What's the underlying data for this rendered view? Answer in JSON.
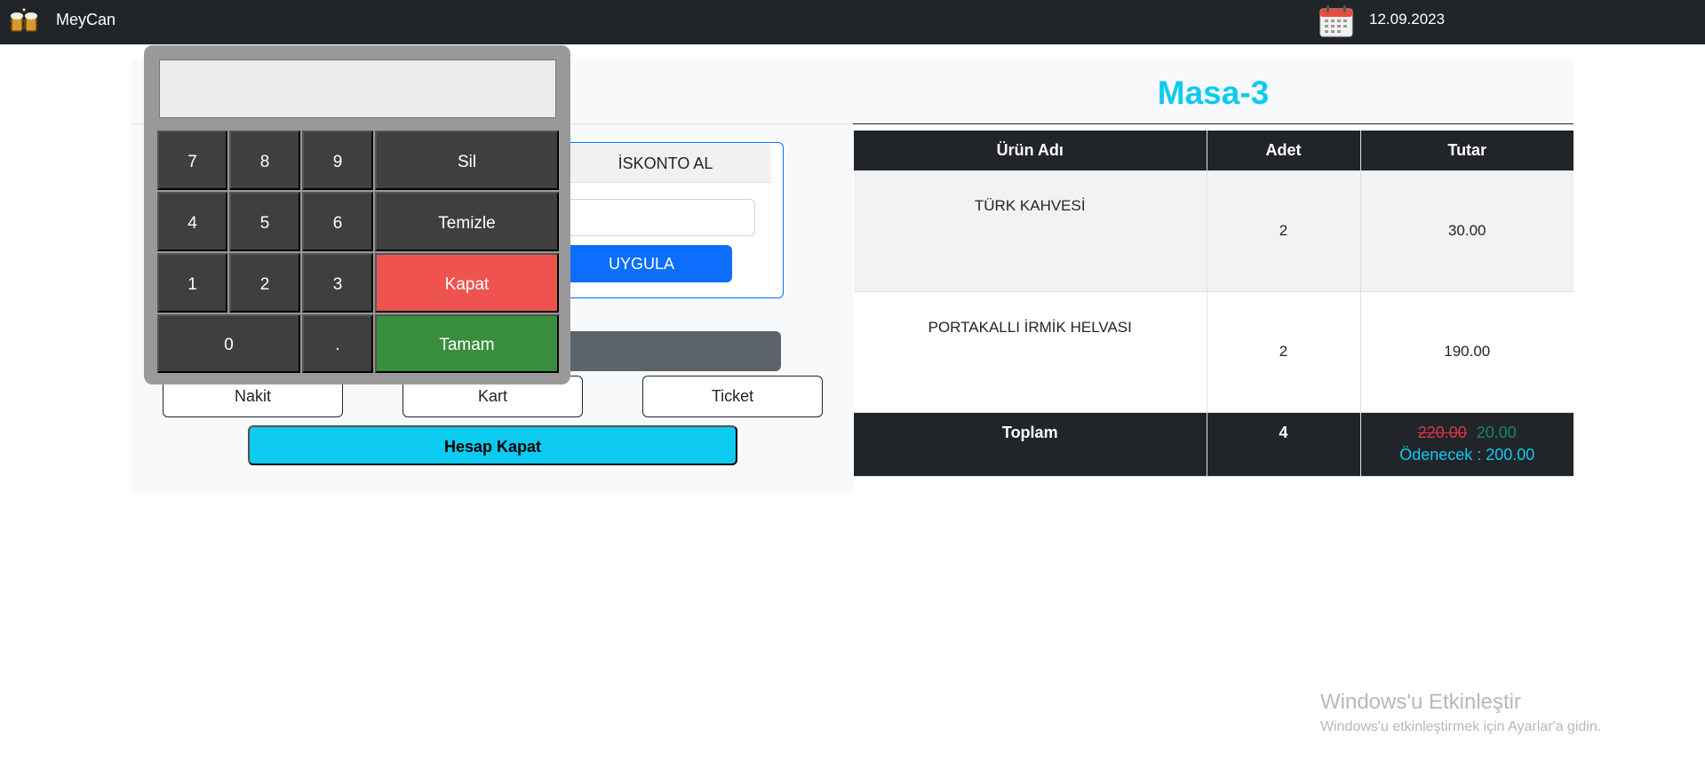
{
  "navbar": {
    "brand": "MeyCan",
    "logo_icon": "beer-mugs-icon",
    "calendar_icon": "calendar-icon",
    "date": "12.09.2023"
  },
  "table_title": "Masa-3",
  "discount": {
    "tab_label": "İSKONTO AL",
    "input_value": "",
    "apply_label": "UYGULA"
  },
  "payment": {
    "cash_label": "Nakit",
    "card_label": "Kart",
    "ticket_label": "Ticket",
    "close_account_label": "Hesap Kapat"
  },
  "keypad": {
    "display_value": "",
    "keys": {
      "k7": "7",
      "k8": "8",
      "k9": "9",
      "k4": "4",
      "k5": "5",
      "k6": "6",
      "k1": "1",
      "k2": "2",
      "k3": "3",
      "k0": "0",
      "dot": ".",
      "delete": "Sil",
      "clear": "Temizle",
      "close": "Kapat",
      "ok": "Tamam"
    }
  },
  "order_table": {
    "headers": {
      "name": "Ürün Adı",
      "qty": "Adet",
      "amount": "Tutar"
    },
    "rows": [
      {
        "name": "TÜRK KAHVESİ",
        "qty": "2",
        "amount": "30.00"
      },
      {
        "name": "PORTAKALLI İRMİK HELVASI",
        "qty": "2",
        "amount": "190.00"
      }
    ],
    "footer": {
      "label": "Toplam",
      "qty": "4",
      "old_total": "220.00",
      "discount": "20.00",
      "payable": "Ödenecek : 200.00"
    }
  },
  "watermark": {
    "title": "Windows'u Etkinleştir",
    "subtitle": "Windows'u etkinleştirmek için Ayarlar'a gidin."
  }
}
